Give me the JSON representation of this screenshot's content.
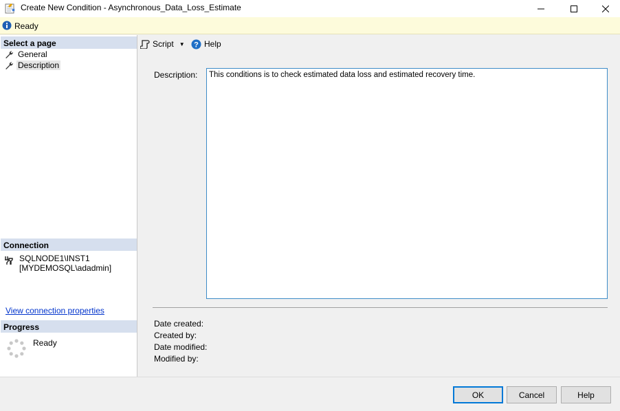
{
  "window": {
    "title": "Create New Condition - Asynchronous_Data_Loss_Estimate"
  },
  "status": {
    "text": "Ready"
  },
  "left_pane": {
    "select_page_header": "Select a page",
    "pages": [
      {
        "label": "General",
        "icon": "wrench-icon"
      },
      {
        "label": "Description",
        "icon": "wrench-icon",
        "selected": true
      }
    ],
    "connection_header": "Connection",
    "connection_server": "SQLNODE1\\INST1",
    "connection_user": "[MYDEMOSQL\\adadmin]",
    "connection_link": "View connection properties",
    "progress_header": "Progress",
    "progress_status": "Ready"
  },
  "toolbar": {
    "script_label": "Script",
    "help_label": "Help"
  },
  "form": {
    "description_label": "Description:",
    "description_value": "This conditions is to check estimated data loss and estimated recovery time.",
    "date_created_label": "Date created:",
    "created_by_label": "Created by:",
    "date_modified_label": "Date modified:",
    "modified_by_label": "Modified by:"
  },
  "buttons": {
    "ok": "OK",
    "cancel": "Cancel",
    "help": "Help"
  },
  "colors": {
    "status_bg": "#fdfbdb",
    "section_header_bg": "#d6dfee",
    "accent": "#0078d7",
    "link": "#0033cc"
  }
}
